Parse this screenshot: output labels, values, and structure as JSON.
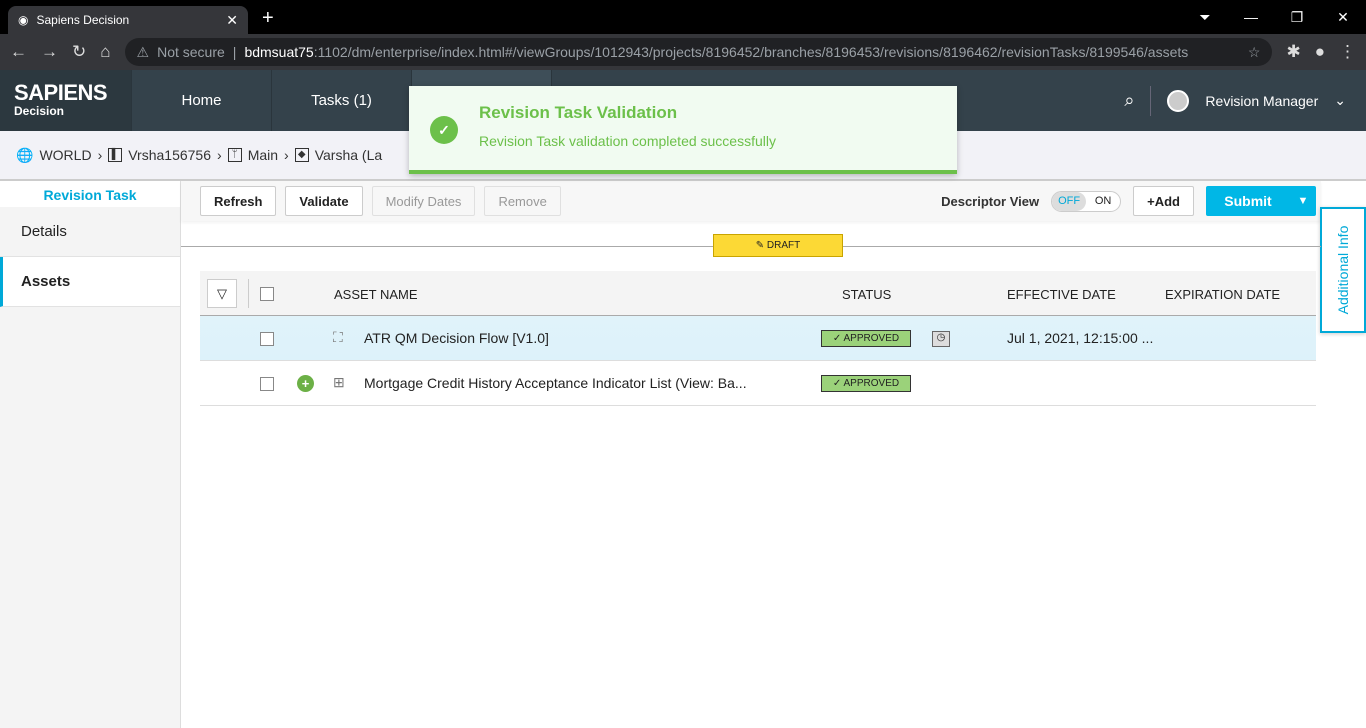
{
  "browser": {
    "tab_title": "Sapiens Decision",
    "security": "Not secure",
    "host": "bdmsuat75",
    "url_rest": ":1102/dm/enterprise/index.html#/viewGroups/1012943/projects/8196452/branches/8196453/revisions/8196462/revisionTasks/8199546/assets"
  },
  "app": {
    "logo_main": "SAPIENS",
    "logo_sub": "Decision",
    "nav": [
      "Home",
      "Tasks  (1)"
    ],
    "user": "Revision Manager"
  },
  "breadcrumb": [
    "WORLD",
    "Vrsha156756",
    "Main",
    "Varsha (La"
  ],
  "toast": {
    "title": "Revision Task Validation",
    "message": "Revision Task validation completed successfully"
  },
  "sidebar": {
    "heading": "Revision Task",
    "items": [
      "Details",
      "Assets"
    ]
  },
  "toolbar": {
    "refresh": "Refresh",
    "validate": "Validate",
    "modify_dates": "Modify Dates",
    "remove": "Remove",
    "descriptor_label": "Descriptor View",
    "toggle_off": "OFF",
    "toggle_on": "ON",
    "add": "+Add",
    "submit": "Submit"
  },
  "additional_info": "Additional Info",
  "draft_label": "DRAFT",
  "table": {
    "headers": {
      "name": "ASSET NAME",
      "status": "STATUS",
      "effective": "EFFECTIVE DATE",
      "expiration": "EXPIRATION DATE"
    },
    "rows": [
      {
        "name": "ATR QM Decision Flow [V1.0]",
        "status": "APPROVED",
        "effective": "Jul 1, 2021, 12:15:00 ..."
      },
      {
        "name": "Mortgage Credit History Acceptance Indicator List (View: Ba...",
        "status": "APPROVED"
      }
    ]
  },
  "colors": {
    "accent": "#00a9d8",
    "success": "#6cc04a",
    "draft": "#fcd935",
    "approved": "#9bd27a"
  }
}
